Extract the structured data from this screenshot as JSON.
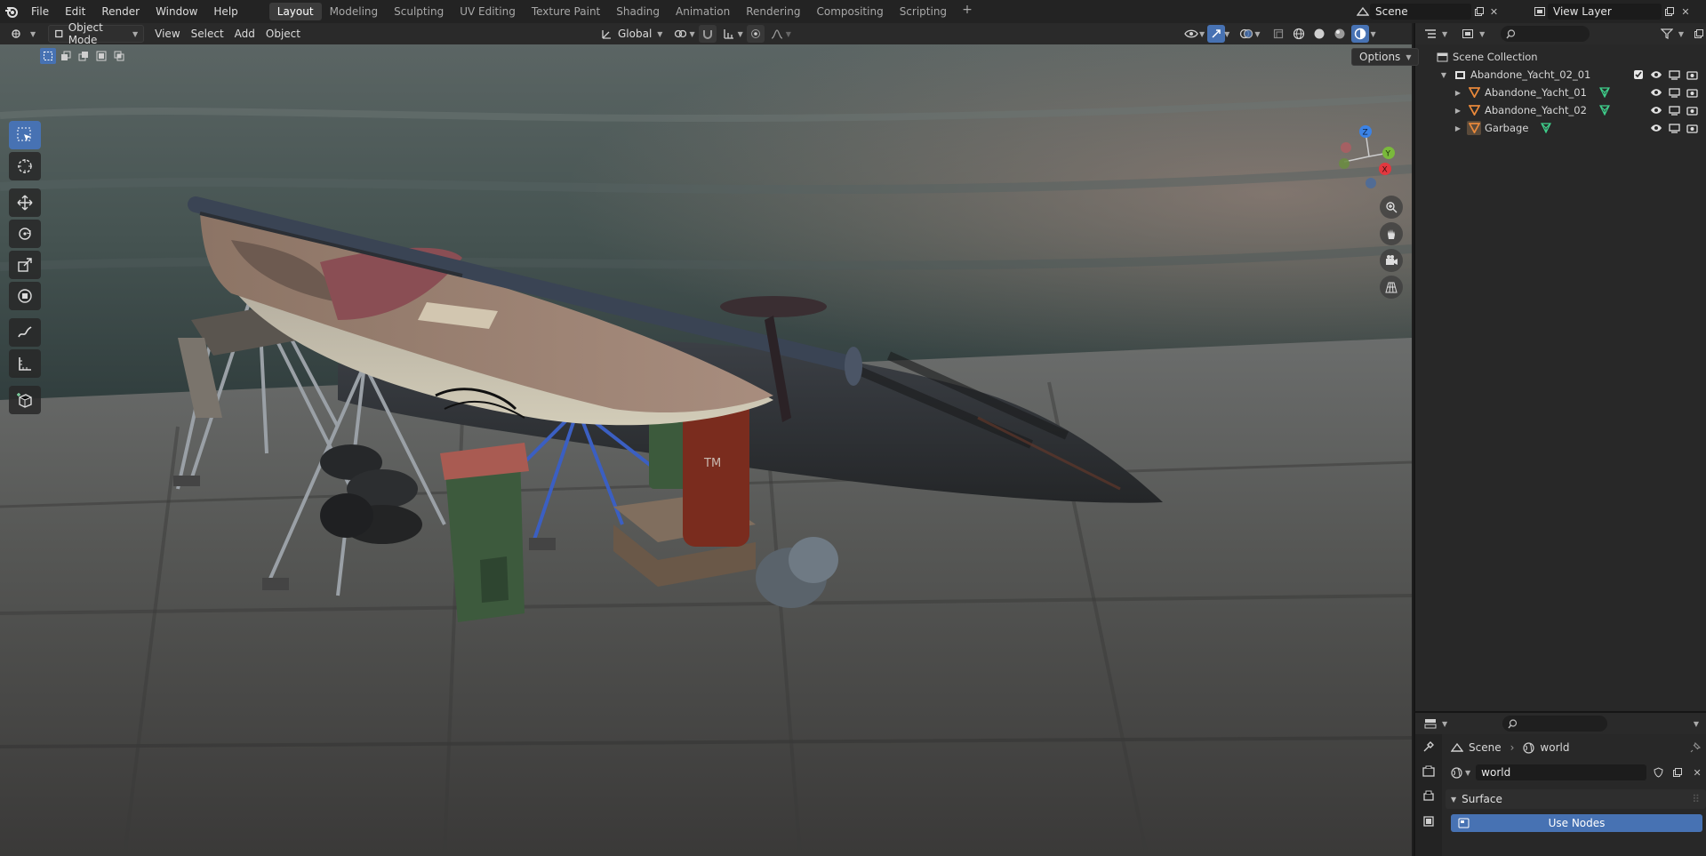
{
  "menu": [
    "File",
    "Edit",
    "Render",
    "Window",
    "Help"
  ],
  "workspaces": [
    "Layout",
    "Modeling",
    "Sculpting",
    "UV Editing",
    "Texture Paint",
    "Shading",
    "Animation",
    "Rendering",
    "Compositing",
    "Scripting"
  ],
  "active_workspace": "Layout",
  "scene_name": "Scene",
  "view_layer": "View Layer",
  "viewport_header": {
    "mode": "Object Mode",
    "menus": [
      "View",
      "Select",
      "Add",
      "Object"
    ],
    "orientation": "Global"
  },
  "options_label": "Options",
  "scene_labels": {
    "barrel_mark": "TM"
  },
  "outliner": {
    "root": "Scene Collection",
    "collection": "Abandone_Yacht_02_01",
    "items": [
      "Abandone_Yacht_01",
      "Abandone_Yacht_02",
      "Garbage"
    ]
  },
  "properties": {
    "breadcrumb_scene": "Scene",
    "breadcrumb_world": "world",
    "world_name": "world",
    "panel_title": "Surface",
    "use_nodes_label": "Use Nodes"
  },
  "colors": {
    "accent": "#4772b3",
    "mesh_icon": "#e8883a",
    "modifier_icon": "#3fd08c"
  }
}
